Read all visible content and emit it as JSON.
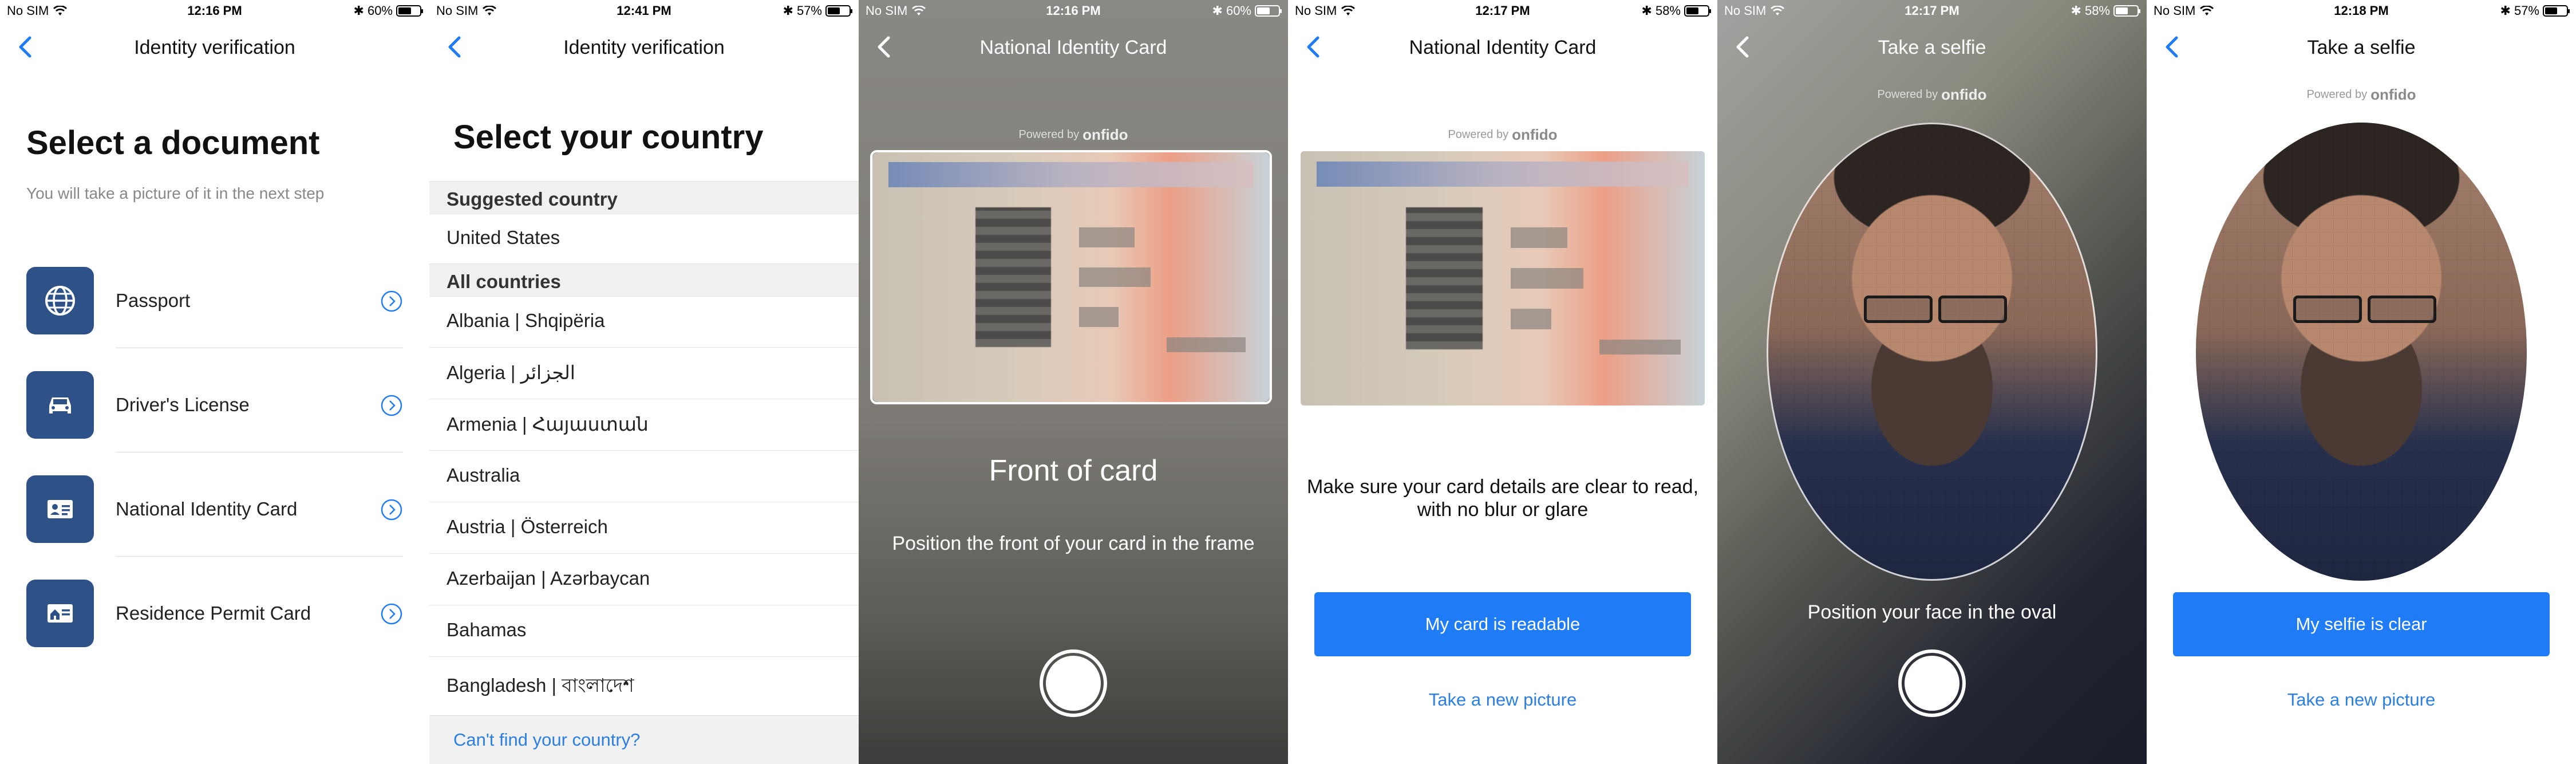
{
  "screens": [
    {
      "status": {
        "carrier": "No SIM",
        "time": "12:16 PM",
        "battery": "60%",
        "battery_level": 0.6
      },
      "nav_title": "Identity verification",
      "heading": "Select a document",
      "subheading": "You will take a picture of it in the next step",
      "documents": [
        {
          "label": "Passport",
          "icon": "globe-icon"
        },
        {
          "label": "Driver's License",
          "icon": "car-icon"
        },
        {
          "label": "National Identity Card",
          "icon": "id-card-icon"
        },
        {
          "label": "Residence Permit Card",
          "icon": "house-card-icon"
        }
      ]
    },
    {
      "status": {
        "carrier": "No SIM",
        "time": "12:41 PM",
        "battery": "57%",
        "battery_level": 0.57
      },
      "nav_title": "Identity verification",
      "heading": "Select your country",
      "suggested_header": "Suggested country",
      "suggested": "United States",
      "all_header": "All countries",
      "countries": [
        "Albania | Shqipëria",
        "Algeria | الجزائر",
        "Armenia | Հայաստան",
        "Australia",
        "Austria | Österreich",
        "Azerbaijan | Azərbaycan",
        "Bahamas",
        "Bangladesh | বাংলাদেশ"
      ],
      "cant_find": "Can't find your country?"
    },
    {
      "status": {
        "carrier": "No SIM",
        "time": "12:16 PM",
        "battery": "60%",
        "battery_level": 0.6
      },
      "nav_title": "National Identity Card",
      "powered": "Powered by",
      "brand": "onfido",
      "title": "Front of card",
      "instruction": "Position the front of your card in the frame"
    },
    {
      "status": {
        "carrier": "No SIM",
        "time": "12:17 PM",
        "battery": "58%",
        "battery_level": 0.58
      },
      "nav_title": "National Identity Card",
      "powered": "Powered by",
      "brand": "onfido",
      "message_line1": "Make sure your card details are clear to read,",
      "message_line2": "with no blur or glare",
      "primary_button": "My card is readable",
      "secondary_link": "Take a new picture"
    },
    {
      "status": {
        "carrier": "No SIM",
        "time": "12:17 PM",
        "battery": "58%",
        "battery_level": 0.58
      },
      "nav_title": "Take a selfie",
      "powered": "Powered by",
      "brand": "onfido",
      "instruction": "Position your face in the oval"
    },
    {
      "status": {
        "carrier": "No SIM",
        "time": "12:18 PM",
        "battery": "57%",
        "battery_level": 0.57
      },
      "nav_title": "Take a selfie",
      "powered": "Powered by",
      "brand": "onfido",
      "primary_button": "My selfie is clear",
      "secondary_link": "Take a new picture"
    }
  ],
  "colors": {
    "accent": "#1f7cf6",
    "tile": "#2e5288",
    "link": "#2b7fe0"
  }
}
